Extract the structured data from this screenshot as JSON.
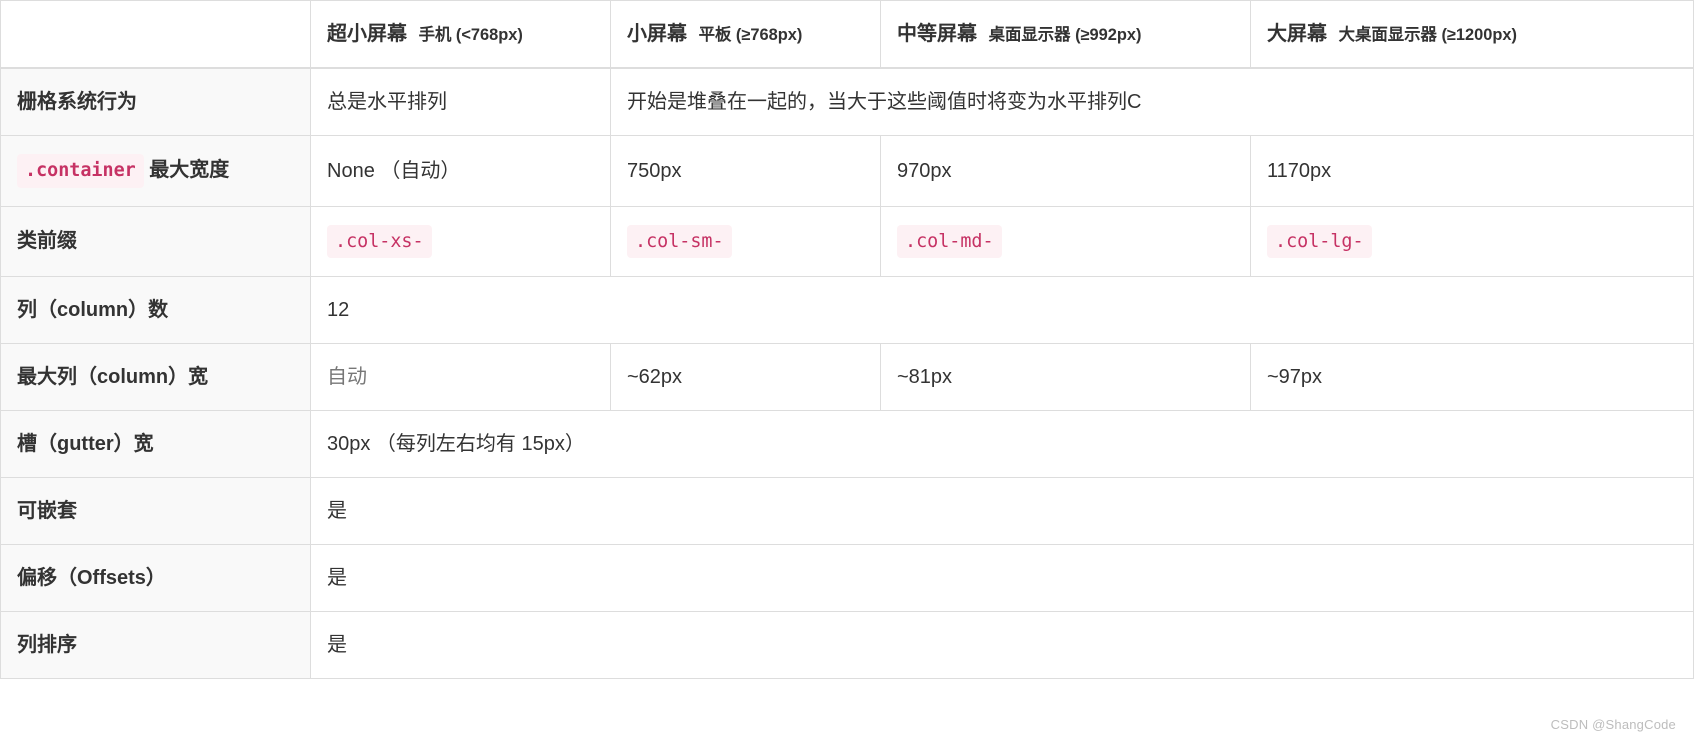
{
  "headers": {
    "corner": "",
    "col1_main": "超小屏幕",
    "col1_sub": "手机 (<768px)",
    "col2_main": "小屏幕",
    "col2_sub": "平板 (≥768px)",
    "col3_main": "中等屏幕",
    "col3_sub": "桌面显示器 (≥992px)",
    "col4_main": "大屏幕",
    "col4_sub": "大桌面显示器 (≥1200px)"
  },
  "rows": {
    "behavior": {
      "label": "栅格系统行为",
      "xs": "总是水平排列",
      "merged": "开始是堆叠在一起的，当大于这些阈值时将变为水平排列C"
    },
    "container": {
      "label_code": ".container",
      "label_suffix": "最大宽度",
      "xs": "None （自动）",
      "sm": "750px",
      "md": "970px",
      "lg": "1170px"
    },
    "prefix": {
      "label": "类前缀",
      "xs": ".col-xs-",
      "sm": ".col-sm-",
      "md": ".col-md-",
      "lg": ".col-lg-"
    },
    "columns": {
      "label": "列（column）数",
      "val": "12"
    },
    "maxcol": {
      "label": "最大列（column）宽",
      "xs": "自动",
      "sm": "~62px",
      "md": "~81px",
      "lg": "~97px"
    },
    "gutter": {
      "label": "槽（gutter）宽",
      "val": "30px （每列左右均有 15px）"
    },
    "nestable": {
      "label": "可嵌套",
      "val": "是"
    },
    "offsets": {
      "label": "偏移（Offsets）",
      "val": "是"
    },
    "ordering": {
      "label": "列排序",
      "val": "是"
    }
  },
  "watermark": "CSDN @ShangCode"
}
